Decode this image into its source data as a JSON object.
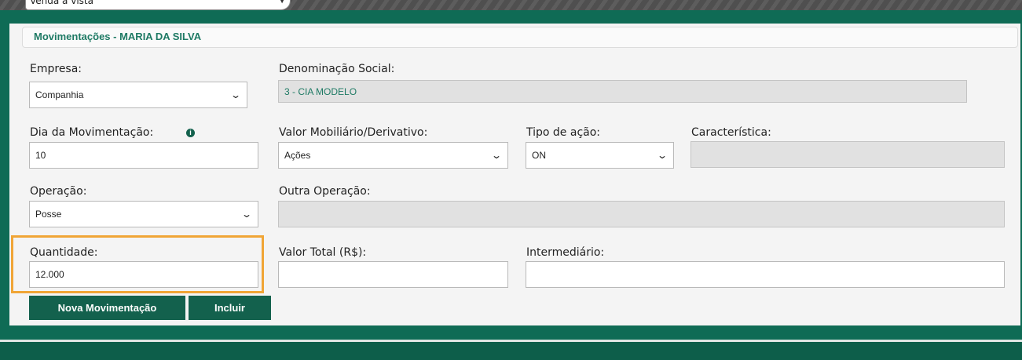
{
  "top_select": {
    "value": "Venda a vista"
  },
  "panel": {
    "title": "Movimentações - MARIA DA SILVA"
  },
  "form": {
    "empresa": {
      "label": "Empresa:",
      "value": "Companhia"
    },
    "denominacao": {
      "label": "Denominação Social:",
      "value": "3 - CIA MODELO"
    },
    "dia": {
      "label": "Dia da Movimentação:",
      "value": "10"
    },
    "valor_mobiliario": {
      "label": "Valor Mobiliário/Derivativo:",
      "value": "Ações"
    },
    "tipo_acao": {
      "label": "Tipo de ação:",
      "value": "ON"
    },
    "caracteristica": {
      "label": "Característica:",
      "value": ""
    },
    "operacao": {
      "label": "Operação:",
      "value": "Posse"
    },
    "outra_operacao": {
      "label": "Outra Operação:",
      "value": ""
    },
    "quantidade": {
      "label": "Quantidade:",
      "value": "12.000"
    },
    "valor_total": {
      "label": "Valor Total (R$):",
      "value": ""
    },
    "intermediario": {
      "label": "Intermediário:",
      "value": ""
    }
  },
  "buttons": {
    "nova": "Nova Movimentação",
    "incluir": "Incluir"
  },
  "icons": {
    "info": "info-icon",
    "dropdown": "chevron-down-icon"
  },
  "colors": {
    "brand": "#0f6b55",
    "button": "#13614d",
    "highlight": "#f0a536",
    "title": "#1e7a64"
  }
}
